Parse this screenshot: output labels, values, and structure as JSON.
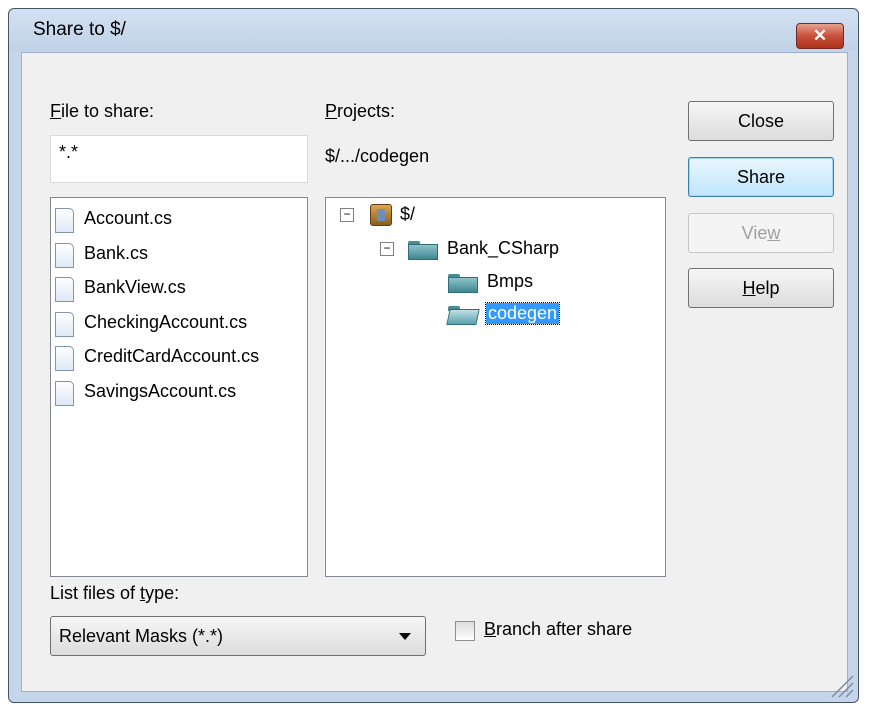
{
  "window": {
    "title": "Share to $/",
    "close_glyph": "✕"
  },
  "file_to_share": {
    "label_underlined": "F",
    "label_rest": "ile to share:",
    "value": "*.*"
  },
  "projects": {
    "label_underlined": "P",
    "label_rest": "rojects:",
    "current_path": "$/.../codegen"
  },
  "files": [
    {
      "name": "Account.cs",
      "icon": "file-icon"
    },
    {
      "name": "Bank.cs",
      "icon": "file-icon"
    },
    {
      "name": "BankView.cs",
      "icon": "file-icon"
    },
    {
      "name": "CheckingAccount.cs",
      "icon": "file-icon"
    },
    {
      "name": "CreditCardAccount.cs",
      "icon": "file-icon"
    },
    {
      "name": "SavingsAccount.cs",
      "icon": "file-icon"
    }
  ],
  "tree": {
    "root": {
      "label": "$/",
      "expander": "−"
    },
    "bank": {
      "label": "Bank_CSharp",
      "expander": "−"
    },
    "bmps": {
      "label": "Bmps"
    },
    "codegen": {
      "label": "codegen",
      "selected": true
    }
  },
  "buttons": {
    "close": "Close",
    "share": "Share",
    "view_prefix": "Vie",
    "view_underlined": "w",
    "help_underlined": "H",
    "help_rest": "elp"
  },
  "list_files": {
    "label_prefix": "List files of ",
    "label_underlined": "t",
    "label_rest": "ype:",
    "selected": "Relevant Masks (*.*)"
  },
  "branch": {
    "label_underlined": "B",
    "label_rest": "ranch after share",
    "checked": false
  },
  "colors": {
    "selection": "#3399ff",
    "default_button": "#bee6fd",
    "close_button": "#c7503b"
  }
}
